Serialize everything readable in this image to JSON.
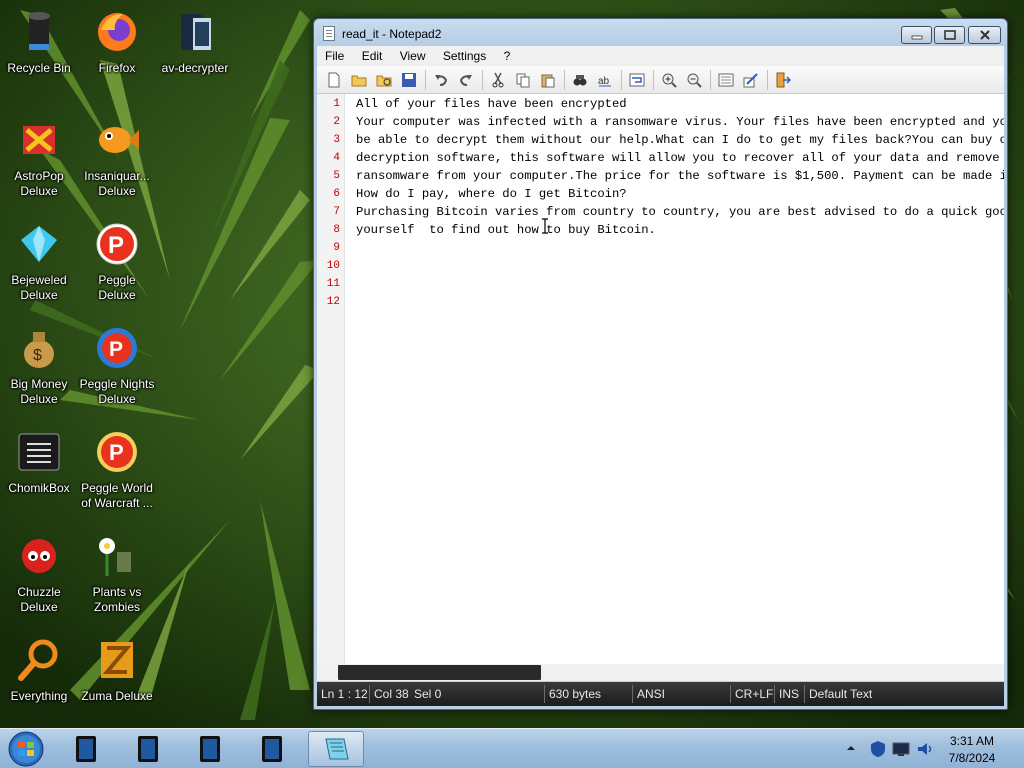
{
  "desktop": {
    "icons": [
      {
        "label": "Recycle Bin",
        "icon": "recycle-bin-icon"
      },
      {
        "label": "Firefox",
        "icon": "firefox-icon"
      },
      {
        "label": "av-decrypter",
        "icon": "av-decrypter-icon"
      },
      {
        "label": "AstroPop Deluxe",
        "icon": "astropop-icon"
      },
      {
        "label": "Insaniquar... Deluxe",
        "icon": "insaniquarium-icon"
      },
      {
        "label": "Bejeweled Deluxe",
        "icon": "bejeweled-icon"
      },
      {
        "label": "Peggle Deluxe",
        "icon": "peggle-icon"
      },
      {
        "label": "Big Money Deluxe",
        "icon": "money-bag-icon"
      },
      {
        "label": "Peggle Nights Deluxe",
        "icon": "peggle-nights-icon"
      },
      {
        "label": "ChomikBox",
        "icon": "chomikbox-icon"
      },
      {
        "label": "Peggle World of Warcraft ...",
        "icon": "peggle-wow-icon"
      },
      {
        "label": "Chuzzle Deluxe",
        "icon": "chuzzle-icon"
      },
      {
        "label": "Plants vs Zombies",
        "icon": "plants-vs-zombies-icon"
      },
      {
        "label": "Everything",
        "icon": "magnifier-icon"
      },
      {
        "label": "Zuma Deluxe",
        "icon": "zuma-icon"
      }
    ]
  },
  "window": {
    "title": "read_it - Notepad2",
    "menu": [
      "File",
      "Edit",
      "View",
      "Settings",
      "?"
    ],
    "toolbar_icons": [
      "new-file-icon",
      "open-folder-icon",
      "browse-icon",
      "save-icon",
      "undo-icon",
      "redo-icon",
      "cut-icon",
      "copy-icon",
      "paste-icon",
      "find-icon",
      "replace-icon",
      "word-wrap-icon",
      "zoom-in-icon",
      "zoom-out-icon",
      "scheme-icon",
      "customize-icon",
      "exit-icon"
    ],
    "editor": {
      "line_numbers": [
        "1",
        "2",
        "3",
        "4",
        "5",
        "6",
        "7",
        "8",
        "9",
        "10",
        "11",
        "12"
      ],
      "lines": [
        "All of your files have been encrypted",
        "Your computer was infected with a ransomware virus. Your files have been encrypted and you w",
        "be able to decrypt them without our help.What can I do to get my files back?You can buy our",
        "decryption software, this software will allow you to recover all of your data and remove the",
        "ransomware from your computer.The price for the software is $1,500. Payment can be made in B",
        "How do I pay, where do I get Bitcoin?",
        "Purchasing Bitcoin varies from country to country, you are best advised to do a quick google",
        "yourself  to find out how to buy Bitcoin.",
        "",
        "",
        "",
        ""
      ]
    },
    "status": {
      "position": "Ln 1 : 12",
      "column": "Col 38",
      "selection": "Sel 0",
      "size": "630 bytes",
      "encoding": "ANSI",
      "line_endings": "CR+LF",
      "mode": "INS",
      "scheme": "Default Text"
    }
  },
  "taskbar": {
    "apps": [
      "app-1-icon",
      "app-2-icon",
      "app-3-icon",
      "app-4-icon",
      "notepad2-icon"
    ],
    "clock_time": "3:31 AM",
    "clock_date": "7/8/2024"
  },
  "colors": {
    "line_number": "#c00000",
    "statusbar": "#1c1c1c",
    "taskbar": "#9fbedd"
  }
}
